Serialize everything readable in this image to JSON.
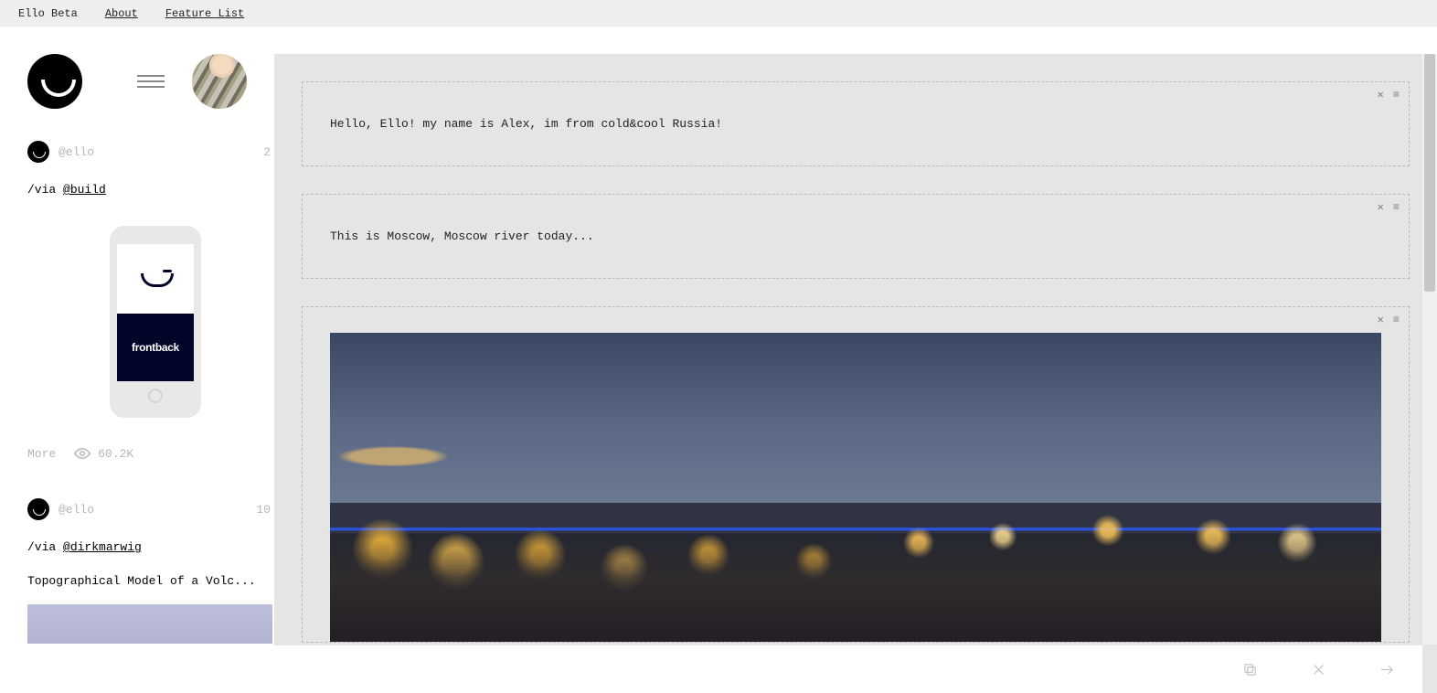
{
  "topbar": {
    "brand": "Ello Beta",
    "about": "About",
    "feature_list": "Feature List"
  },
  "sidebar": {
    "items": [
      {
        "user": "@ello",
        "date": "2",
        "via_prefix": "/via ",
        "via_handle": "@build",
        "phone_label": "frontback",
        "more_label": "More",
        "view_count": "60.2K"
      },
      {
        "user": "@ello",
        "date": "10",
        "via_prefix": "/via ",
        "via_handle": "@dirkmarwig",
        "title": "Topographical Model of a Volc..."
      }
    ]
  },
  "posts": [
    {
      "text": "Hello, Ello! my name is Alex, im from cold&cool Russia!"
    },
    {
      "text": "This is Moscow, Moscow river today..."
    }
  ]
}
